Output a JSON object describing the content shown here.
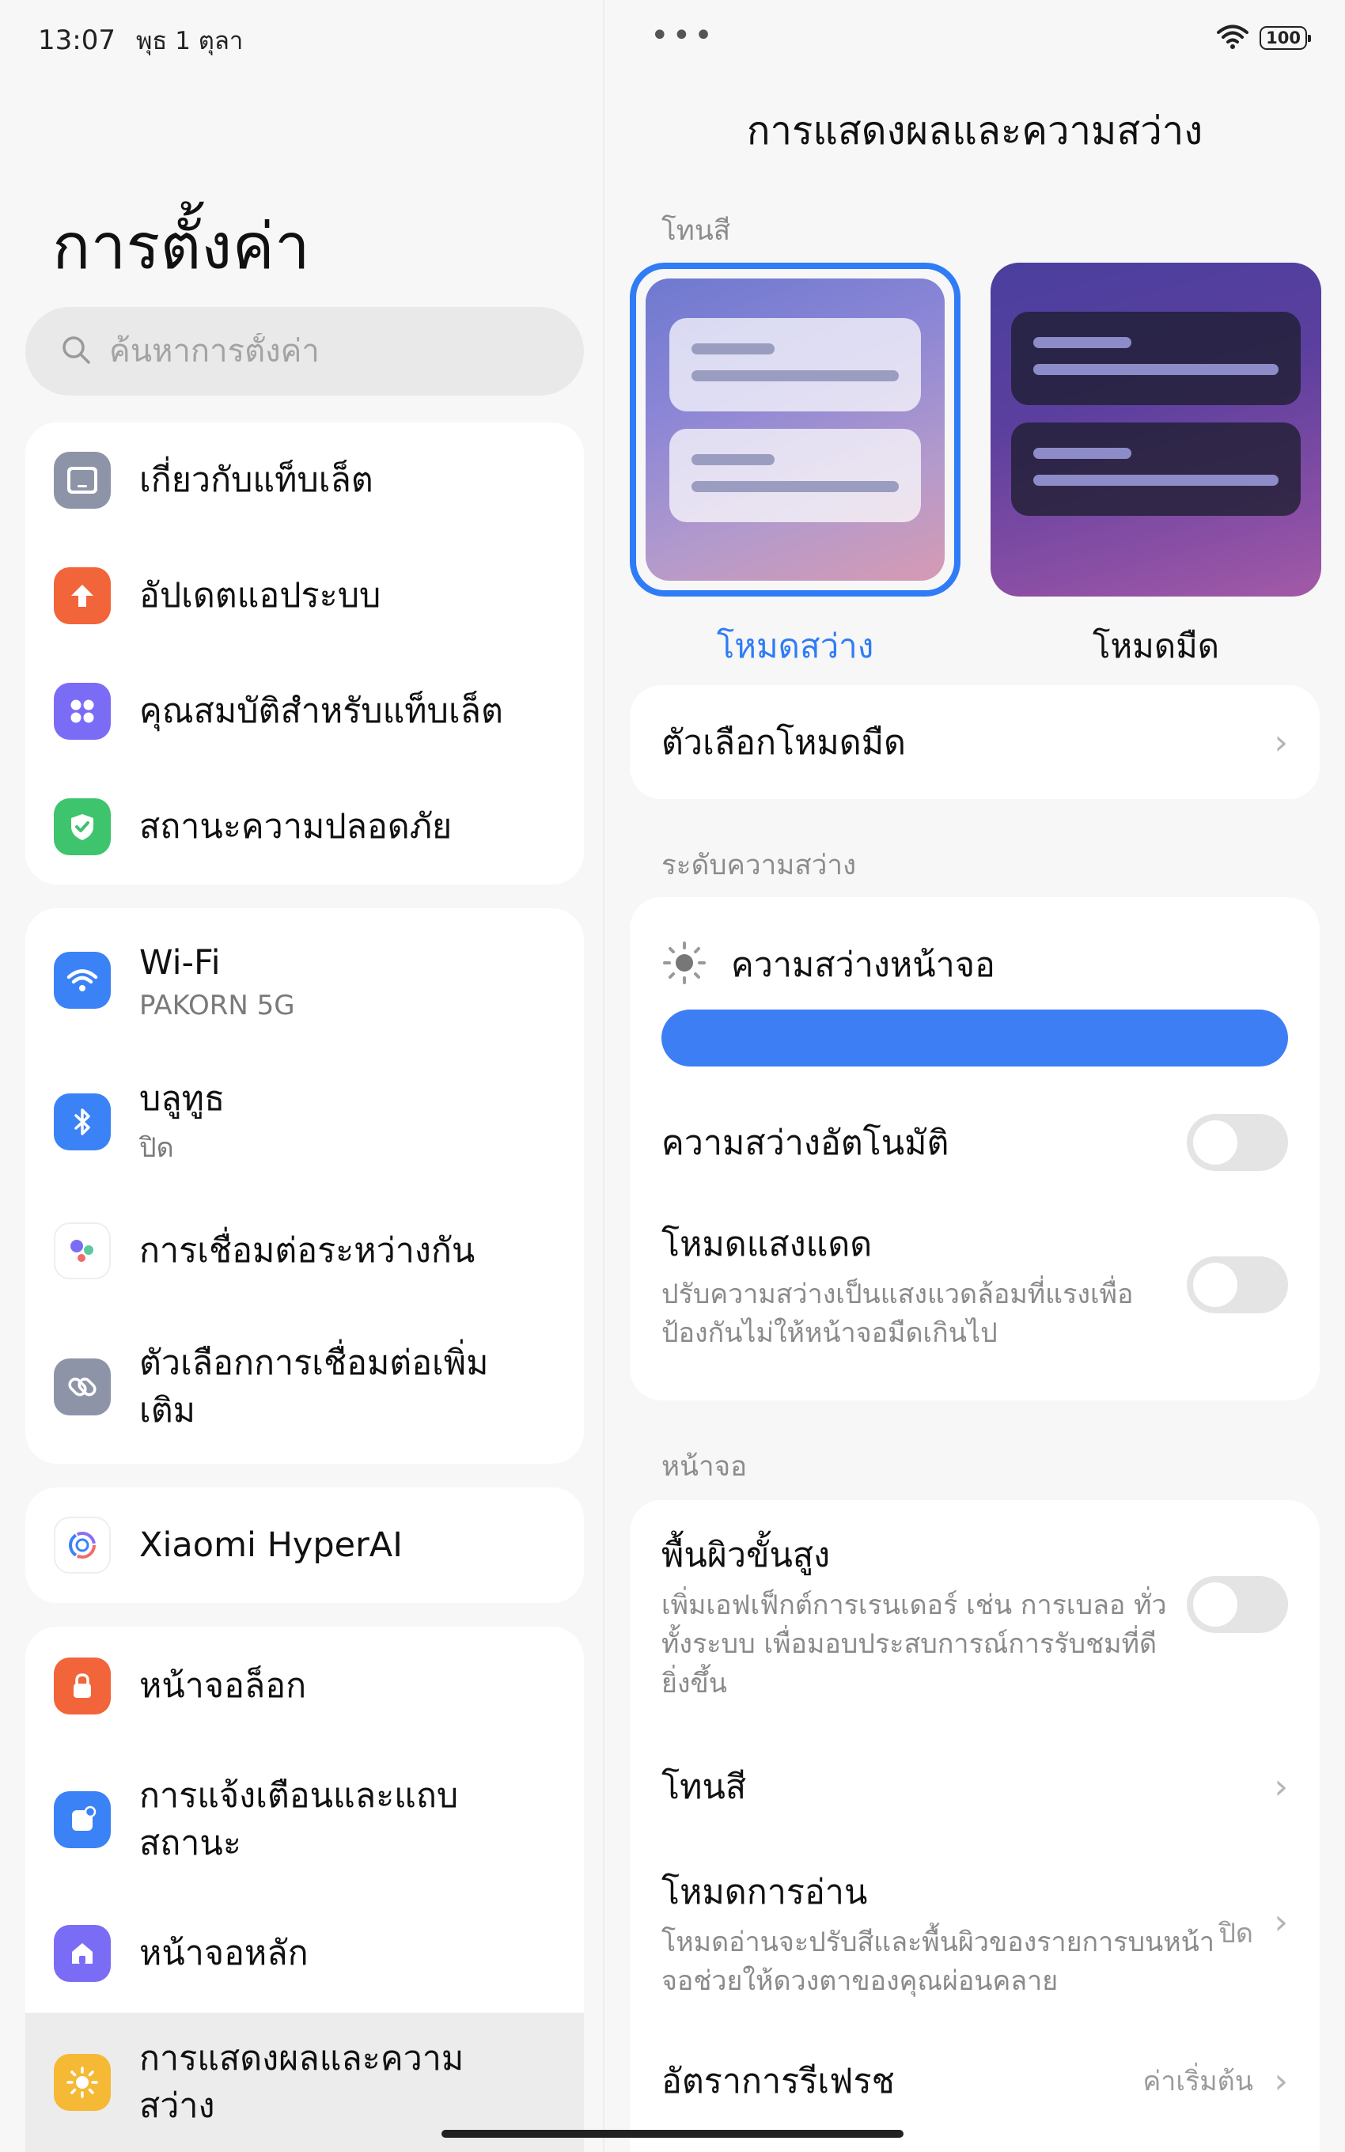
{
  "status": {
    "time": "13:07",
    "date": "พุธ 1 ตุลา",
    "battery": "100"
  },
  "left": {
    "title": "การตั้งค่า",
    "search": {
      "placeholder": "ค้นหาการตั้งค่า"
    },
    "group1": [
      {
        "label": "เกี่ยวกับแท็บเล็ต",
        "icon": "tablet-icon",
        "color": "#8e94a8"
      },
      {
        "label": "อัปเดตแอประบบ",
        "icon": "update-arrow-icon",
        "color": "#f2643a"
      },
      {
        "label": "คุณสมบัติสำหรับแท็บเล็ต",
        "icon": "grid-dots-icon",
        "color": "#7b6cf6"
      },
      {
        "label": "สถานะความปลอดภัย",
        "icon": "shield-check-icon",
        "color": "#3ec46d"
      }
    ],
    "group2": [
      {
        "label": "Wi-Fi",
        "sub": "PAKORN 5G",
        "icon": "wifi-icon",
        "color": "#3b82f6"
      },
      {
        "label": "บลูทูธ",
        "sub": "ปิด",
        "icon": "bluetooth-icon",
        "color": "#3b82f6"
      },
      {
        "label": "การเชื่อมต่อระหว่างกัน",
        "icon": "interconnect-icon",
        "color": "#ffffff"
      },
      {
        "label": "ตัวเลือกการเชื่อมต่อเพิ่ม",
        "label2": "เติม",
        "icon": "link-icon",
        "color": "#8e94a8"
      }
    ],
    "group3": [
      {
        "label": "Xiaomi HyperAI",
        "icon": "hyperai-icon",
        "color": "#ffffff"
      }
    ],
    "group4": [
      {
        "label": "หน้าจอล็อก",
        "icon": "lock-icon",
        "color": "#f2643a"
      },
      {
        "label": "การแจ้งเตือนและแถบ",
        "label2": "สถานะ",
        "icon": "notification-icon",
        "color": "#3b82f6"
      },
      {
        "label": "หน้าจอหลัก",
        "icon": "home-icon",
        "color": "#7b6cf6"
      },
      {
        "label": "การแสดงผลและความ",
        "label2": "สว่าง",
        "icon": "sun-icon",
        "color": "#f5b935"
      }
    ]
  },
  "right": {
    "title": "การแสดงผลและความสว่าง",
    "section_theme": "โทนสี",
    "theme_light": "โหมดสว่าง",
    "theme_dark": "โหมดมืด",
    "dark_options": "ตัวเลือกโหมดมืด",
    "section_brightness": "ระดับความสว่าง",
    "screen_brightness": "ความสว่างหน้าจอ",
    "brightness_level": 1.0,
    "auto_brightness": "ความสว่างอัตโนมัติ",
    "sunlight_mode": "โหมดแสงแดด",
    "sunlight_desc1": "ปรับความสว่างเป็นแสงแวดล้อมที่แรงเพื่อ",
    "sunlight_desc2": "ป้องกันไม่ให้หน้าจอมืดเกินไป",
    "section_screen": "หน้าจอ",
    "advanced_surface": "พื้นผิวขั้นสูง",
    "advanced_desc1": "เพิ่มเอฟเฟ็กต์การเรนเดอร์ เช่น การเบลอ ทั่ว",
    "advanced_desc2": "ทั้งระบบ เพื่อมอบประสบการณ์การรับชมที่ดี",
    "advanced_desc3": "ยิ่งขึ้น",
    "color_tone": "โทนสี",
    "reading_mode": "โหมดการอ่าน",
    "reading_desc1": "โหมดอ่านจะปรับสีและพื้นผิวของรายการบนหน้า",
    "reading_desc2": "จอช่วยให้ดวงตาของคุณผ่อนคลาย",
    "reading_value": "ปิด",
    "refresh_rate": "อัตราการรีเฟรช",
    "refresh_value": "ค่าเริ่มต้น"
  }
}
